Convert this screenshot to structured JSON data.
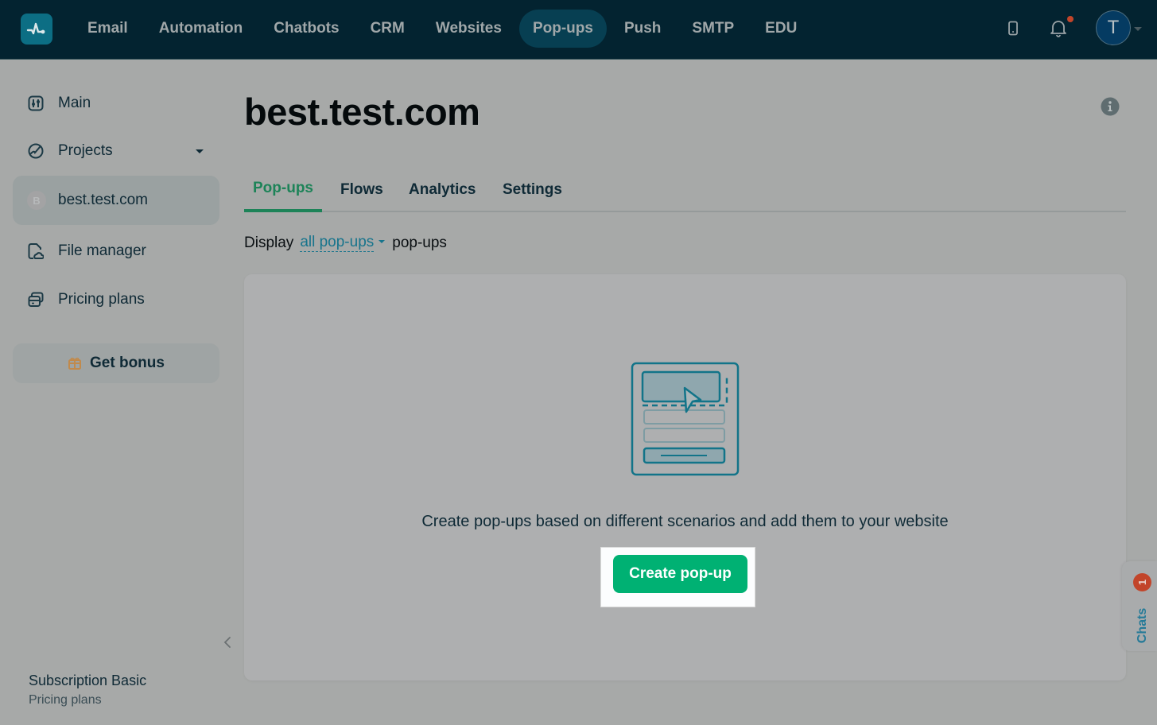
{
  "topnav": {
    "logo": "pulse-logo-icon",
    "items": [
      {
        "label": "Email",
        "active": false
      },
      {
        "label": "Automation",
        "active": false
      },
      {
        "label": "Chatbots",
        "active": false
      },
      {
        "label": "CRM",
        "active": false
      },
      {
        "label": "Websites",
        "active": false
      },
      {
        "label": "Pop-ups",
        "active": true
      },
      {
        "label": "Push",
        "active": false
      },
      {
        "label": "SMTP",
        "active": false
      },
      {
        "label": "EDU",
        "active": false
      }
    ],
    "user_initial": "T",
    "notification_dot": true
  },
  "sidebar": {
    "items": [
      {
        "label": "Main",
        "icon": "sliders-icon"
      },
      {
        "label": "Projects",
        "icon": "projects-icon",
        "expandable": true
      },
      {
        "label": "best.test.com",
        "badge": "B",
        "active": true
      },
      {
        "label": "File manager",
        "icon": "file-manager-icon"
      },
      {
        "label": "Pricing plans",
        "icon": "pricing-icon"
      }
    ],
    "bonus_label": "Get bonus",
    "subscription_title": "Subscription Basic",
    "subscription_link": "Pricing plans"
  },
  "main": {
    "title": "best.test.com",
    "tabs": [
      {
        "label": "Pop-ups",
        "active": true
      },
      {
        "label": "Flows",
        "active": false
      },
      {
        "label": "Analytics",
        "active": false
      },
      {
        "label": "Settings",
        "active": false
      }
    ],
    "filter": {
      "prefix": "Display",
      "selected": "all pop-ups",
      "suffix": "pop-ups"
    },
    "empty_state": {
      "message": "Create pop-ups based on different scenarios and add them to your website",
      "button_label": "Create pop-up"
    }
  },
  "chats": {
    "label": "Chats",
    "count": "1"
  },
  "colors": {
    "topbar": "#032330",
    "accent_green": "#00b173",
    "tab_active": "#1d8358",
    "link": "#17748c",
    "badge_red": "#c2452a"
  }
}
